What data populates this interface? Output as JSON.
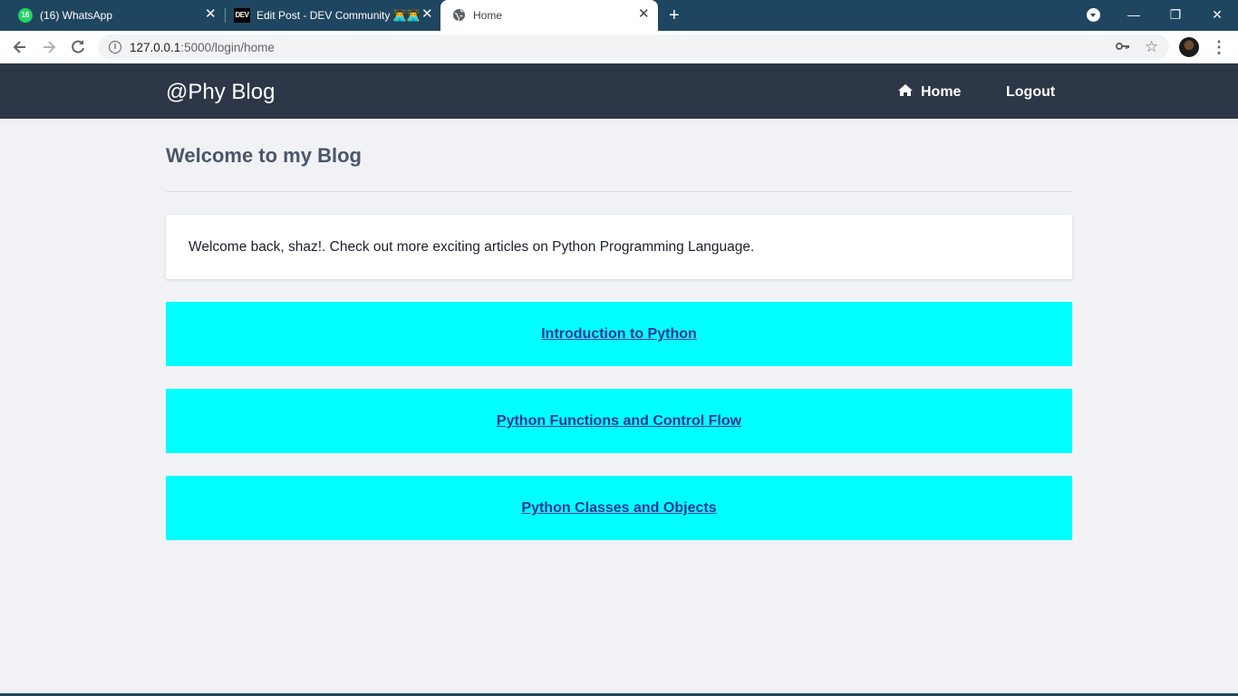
{
  "browser": {
    "tabs": [
      {
        "title": "(16) WhatsApp",
        "badge": "16"
      },
      {
        "title": "Edit Post - DEV Community 👨‍💻👨‍💻",
        "icon_text": "DEV"
      },
      {
        "title": "Home"
      }
    ],
    "url_host": "127.0.0.1",
    "url_rest": ":5000/login/home",
    "icons": {
      "back": "arrow-left-icon",
      "forward": "arrow-right-icon",
      "reload": "reload-icon",
      "info": "info-icon",
      "key": "key-icon",
      "star": "star-icon",
      "menu": "more-vert-icon"
    }
  },
  "site": {
    "brand": "@Phy Blog",
    "nav": {
      "home": "Home",
      "logout": "Logout"
    }
  },
  "main": {
    "title": "Welcome to my Blog",
    "welcome_message": "Welcome back, shaz!. Check out more exciting articles on Python Programming Language.",
    "posts": [
      {
        "title": "Introduction to Python"
      },
      {
        "title": "Python Functions and Control Flow"
      },
      {
        "title": "Python Classes and Objects"
      }
    ]
  },
  "colors": {
    "tabbar": "#1f4660",
    "navbar": "#2d3748",
    "post_card": "#00ffff",
    "post_link": "#2a3596",
    "page_bg": "#f1f2f6",
    "title_text": "#4a5568"
  }
}
